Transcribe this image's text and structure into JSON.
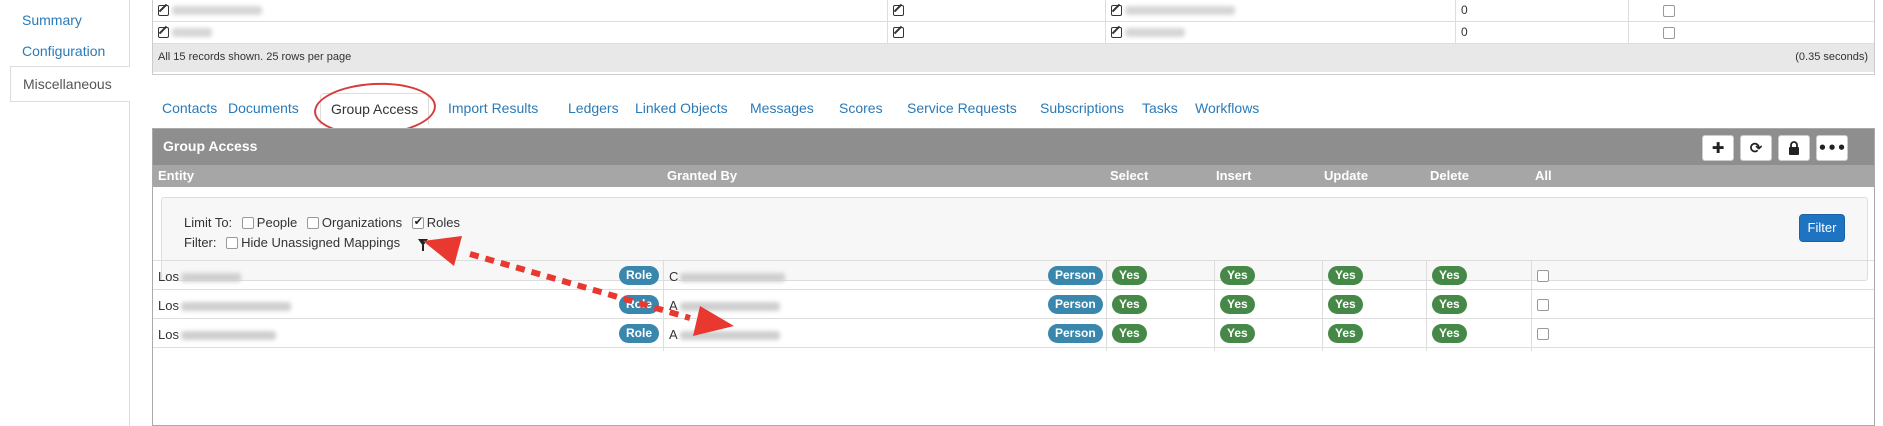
{
  "sidebar": {
    "items": [
      {
        "label": "Summary"
      },
      {
        "label": "Configuration"
      },
      {
        "label": "Miscellaneous"
      }
    ]
  },
  "top_table": {
    "rows": [
      {
        "count": "0"
      },
      {
        "count": "0"
      }
    ],
    "footer_left": "All 15 records shown. 25 rows per page",
    "footer_right": "(0.35 seconds)"
  },
  "tabs": [
    {
      "label": "Contacts"
    },
    {
      "label": "Documents"
    },
    {
      "label": "Group Access"
    },
    {
      "label": "Import Results"
    },
    {
      "label": "Ledgers"
    },
    {
      "label": "Linked Objects"
    },
    {
      "label": "Messages"
    },
    {
      "label": "Scores"
    },
    {
      "label": "Service Requests"
    },
    {
      "label": "Subscriptions"
    },
    {
      "label": "Tasks"
    },
    {
      "label": "Workflows"
    }
  ],
  "active_tab": "Group Access",
  "panel": {
    "title": "Group Access",
    "toolbar": {
      "add_icon": "plus-icon",
      "refresh_icon": "refresh-icon",
      "lock_icon": "lock-icon",
      "more_icon": "more-icon"
    },
    "columns": [
      "Entity",
      "Granted By",
      "Select",
      "Insert",
      "Update",
      "Delete",
      "All"
    ]
  },
  "filters": {
    "limit_label": "Limit To:",
    "options": [
      {
        "label": "People",
        "checked": false
      },
      {
        "label": "Organizations",
        "checked": false
      },
      {
        "label": "Roles",
        "checked": true
      }
    ],
    "filter_label": "Filter:",
    "hide_unassigned_label": "Hide Unassigned Mappings",
    "filter_button": "Filter"
  },
  "rows": [
    {
      "entity_prefix": "Los",
      "entity_badge": "Role",
      "granted_prefix": "C",
      "granted_badge": "Person",
      "select": "Yes",
      "insert": "Yes",
      "update": "Yes",
      "delete": "Yes"
    },
    {
      "entity_prefix": "Los",
      "entity_badge": "Role",
      "granted_prefix": "A",
      "granted_badge": "Person",
      "select": "Yes",
      "insert": "Yes",
      "update": "Yes",
      "delete": "Yes"
    },
    {
      "entity_prefix": "Los",
      "entity_badge": "Role",
      "granted_prefix": "A",
      "granted_badge": "Person",
      "select": "Yes",
      "insert": "Yes",
      "update": "Yes",
      "delete": "Yes"
    }
  ],
  "colors": {
    "link": "#2a7ab8",
    "panel_header": "#8e8e8e",
    "badge_blue": "#3a87ad",
    "badge_green": "#468847",
    "filter_button": "#1f74c2",
    "annotation": "#e8382f"
  }
}
